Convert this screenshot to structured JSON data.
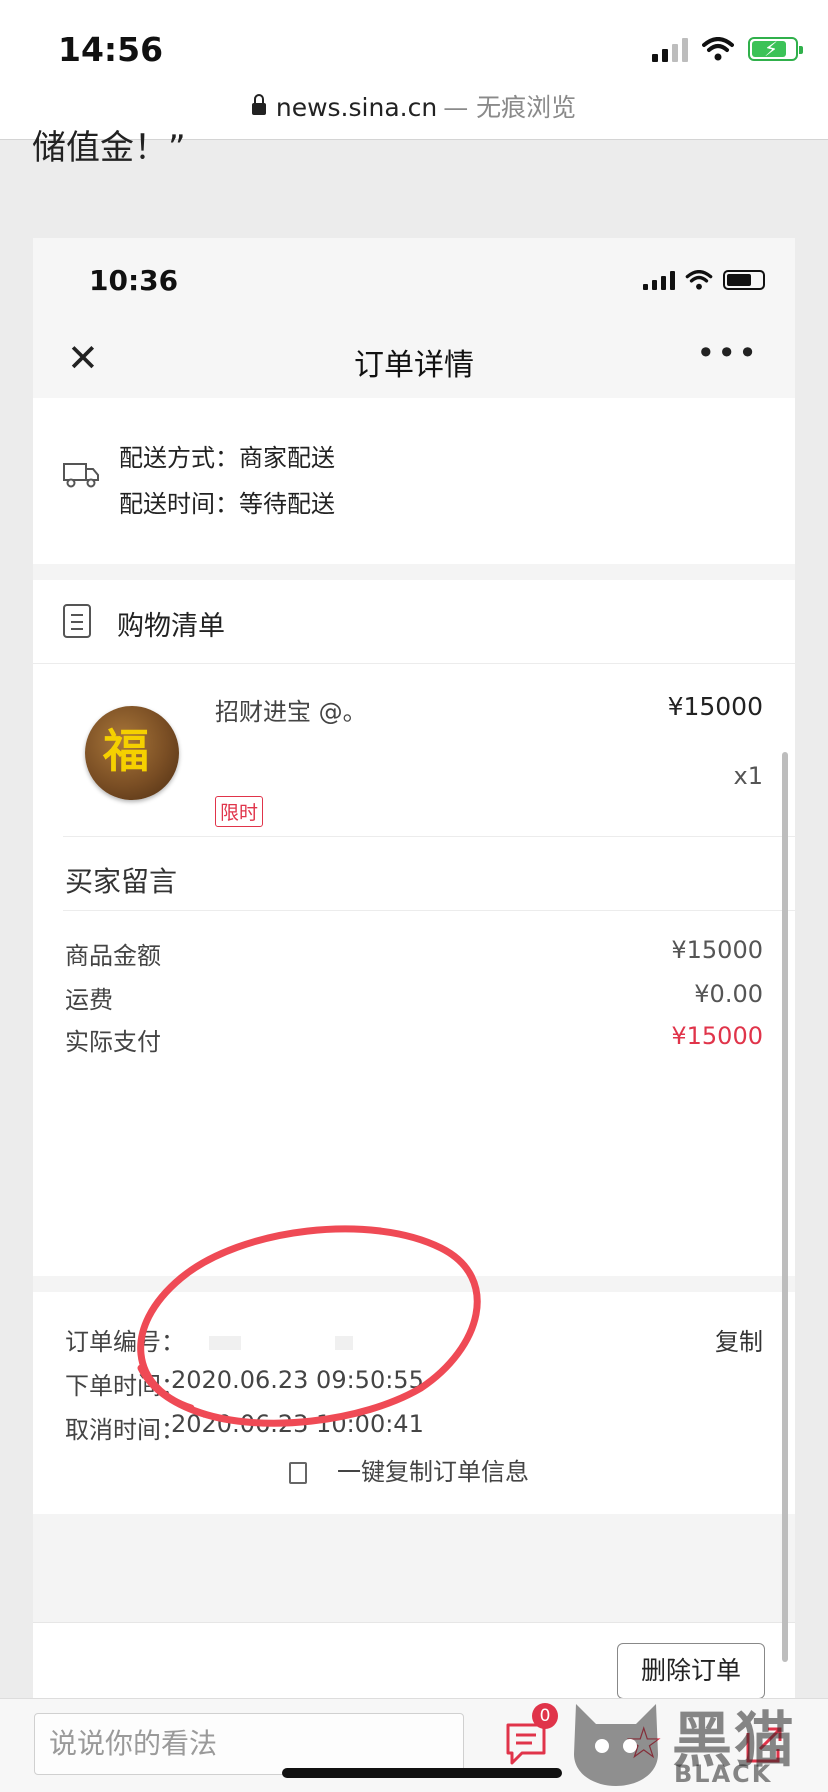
{
  "browser": {
    "time": "14:56",
    "url_domain": "news.sina.cn",
    "url_mode": "— 无痕浏览",
    "article_fragment": "储值金！”"
  },
  "screenshot": {
    "status": {
      "time": "10:36"
    },
    "nav": {
      "title": "订单详情",
      "close_icon": "close-icon",
      "more_icon": "more-icon"
    },
    "delivery": {
      "method_label": "配送方式：",
      "method_value": "商家配送",
      "time_label": "配送时间：",
      "time_value": "等待配送"
    },
    "cart": {
      "title": "购物清单",
      "item": {
        "name": "招财进宝 @。",
        "price": "¥15000",
        "qty": "x1",
        "badge": "限时",
        "image_text": "福"
      },
      "buyer_message_label": "买家留言",
      "rows": [
        {
          "label": "商品金额",
          "value": "¥15000"
        },
        {
          "label": "运费",
          "value": "¥0.00"
        },
        {
          "label": "实际支付",
          "value": "¥15000"
        }
      ]
    },
    "order": {
      "number_label": "订单编号：",
      "copy": "复制",
      "order_time_label": "下单时间：",
      "order_time_value": "2020.06.23 09:50:55",
      "cancel_time_label": "取消时间：",
      "cancel_time_value": "2020.06.23 10:00:41",
      "copy_all": "一键复制订单信息"
    },
    "actions": {
      "delete": "删除订单"
    },
    "colors": {
      "accent": "#e0344a",
      "annotation": "#ef4a55"
    }
  },
  "comment_bar": {
    "placeholder": "说说你的看法",
    "comment_count": "0"
  },
  "watermark": {
    "cn": "黑猫",
    "en": "BLACK CAT"
  }
}
